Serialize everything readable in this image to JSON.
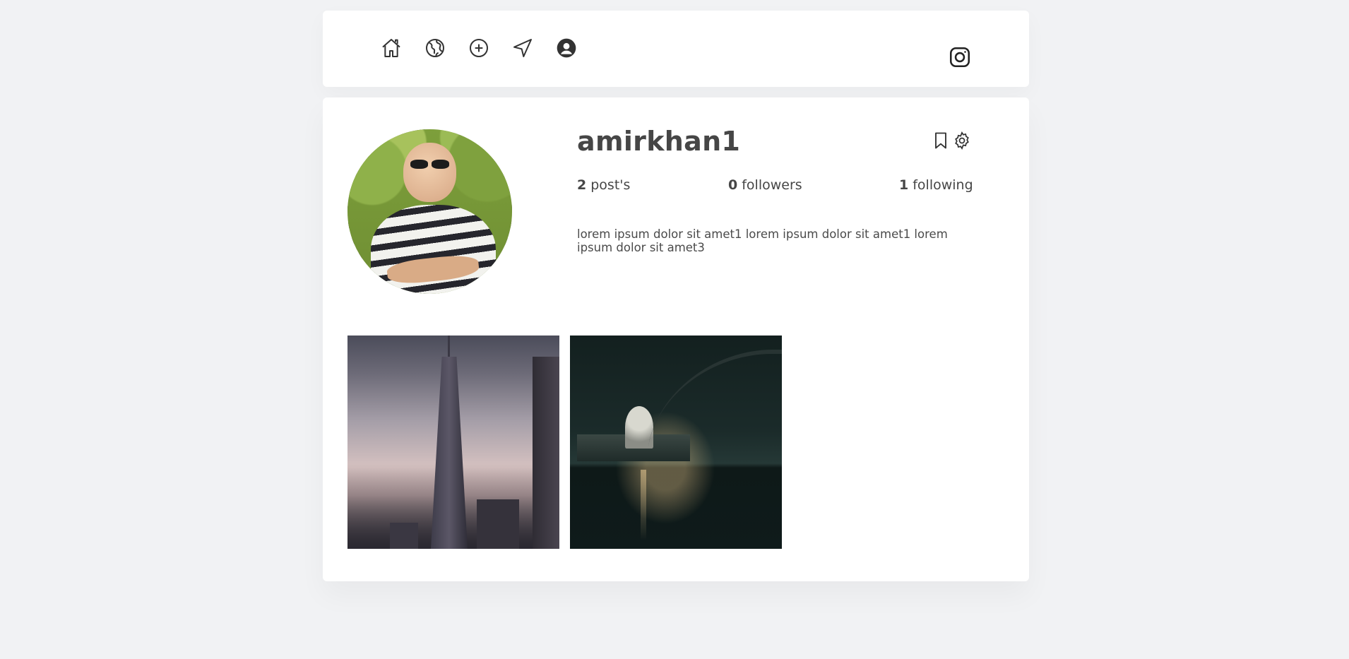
{
  "nav": {
    "icons": [
      "home-icon",
      "globe-icon",
      "plus-circle-icon",
      "navigation-icon",
      "user-circle-icon"
    ],
    "brand_icon": "instagram-icon"
  },
  "profile": {
    "username": "amirkhan1",
    "posts_count": "2",
    "posts_label": "post's",
    "followers_count": "0",
    "followers_label": "followers",
    "following_count": "1",
    "following_label": "following",
    "bio": "lorem ipsum dolor sit amet1 lorem ipsum dolor sit amet1 lorem ipsum dolor sit amet3",
    "action_icons": [
      "bookmark-icon",
      "gear-icon"
    ]
  },
  "posts": [
    {
      "subject": "skyscraper-at-dusk"
    },
    {
      "subject": "city-bridge-at-night"
    }
  ],
  "colors": {
    "background": "#f1f2f4",
    "card": "#ffffff",
    "text": "#464646"
  }
}
